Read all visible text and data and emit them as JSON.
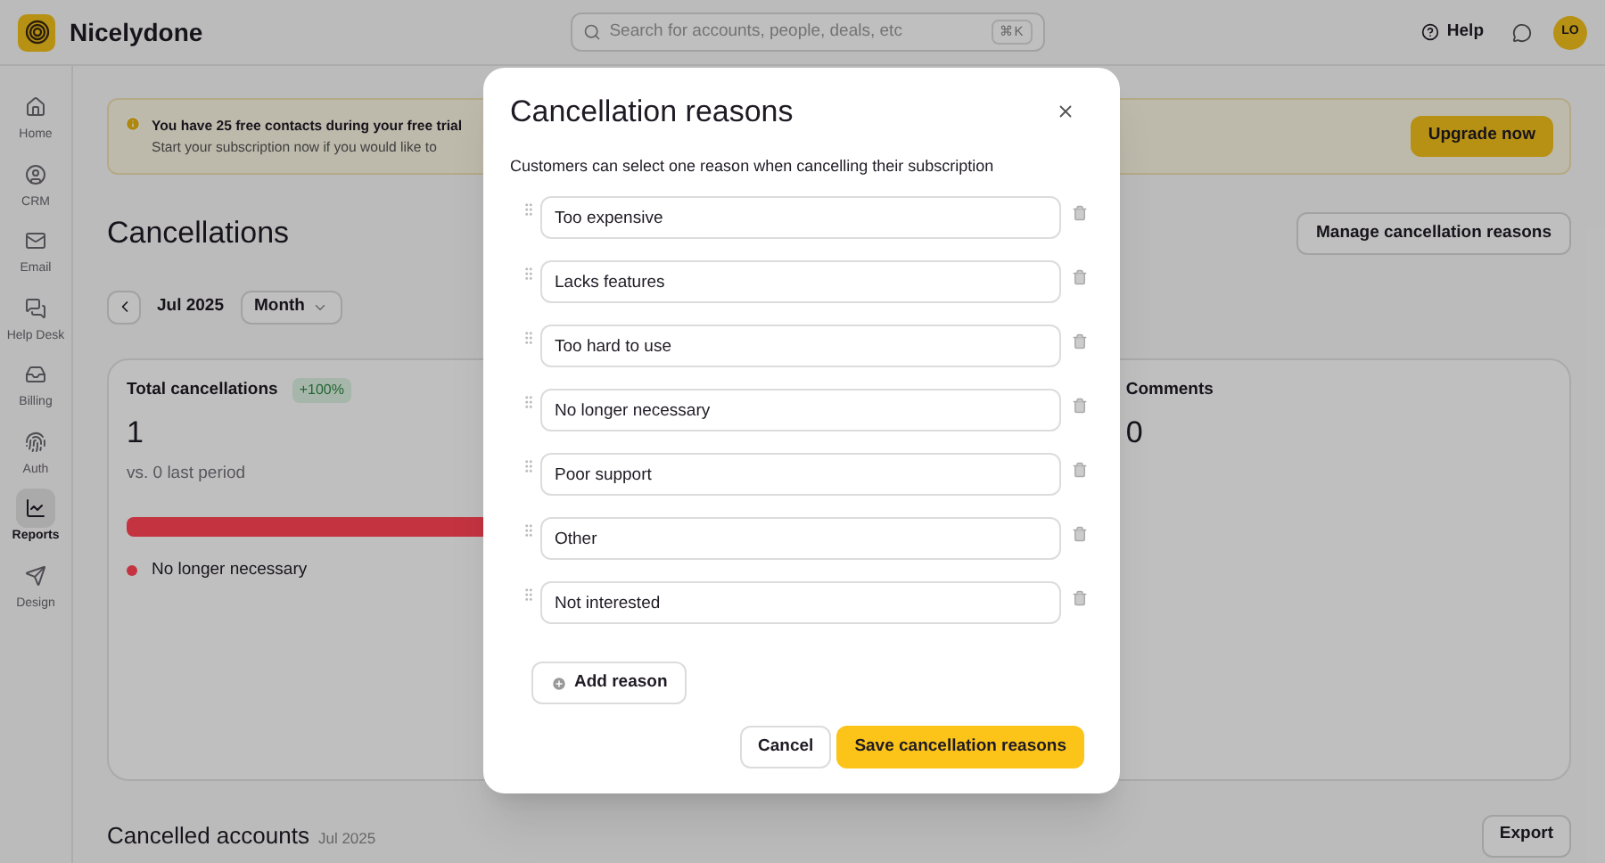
{
  "app": {
    "name": "Nicelydone"
  },
  "search": {
    "placeholder": "Search for accounts, people, deals, etc",
    "shortcut": "⌘K"
  },
  "header_actions": {
    "help": "Help",
    "avatar": "LO"
  },
  "sidebar": {
    "items": [
      {
        "label": "Home",
        "selected": false
      },
      {
        "label": "CRM",
        "selected": false
      },
      {
        "label": "Email",
        "selected": false
      },
      {
        "label": "Help Desk",
        "selected": false
      },
      {
        "label": "Billing",
        "selected": false
      },
      {
        "label": "Auth",
        "selected": false
      },
      {
        "label": "Reports",
        "selected": true
      },
      {
        "label": "Design",
        "selected": false
      }
    ]
  },
  "banner": {
    "title": "You have 25 free contacts during your free trial",
    "text": "Start your subscription now if you would like to",
    "button": "Upgrade now"
  },
  "page": {
    "title": "Cancellations",
    "manage_button": "Manage cancellation reasons",
    "period": "Jul 2025",
    "range": "Month"
  },
  "cards": [
    {
      "kind": "breakdown",
      "title": "Total cancellations",
      "badge": "+100%",
      "value": "1",
      "comparison": "vs. 0 last period",
      "legend": [
        {
          "label": "No longer necessary",
          "color": "#c43340"
        }
      ]
    },
    {
      "kind": "simple",
      "title": "Comments",
      "value": "0"
    }
  ],
  "section": {
    "title": "Cancelled accounts",
    "period": "Jul 2025",
    "export": "Export"
  },
  "dialog": {
    "title": "Cancellation reasons",
    "description": "Customers can select one reason when cancelling their subscription",
    "reasons": [
      {
        "value": "Too expensive"
      },
      {
        "value": "Lacks features"
      },
      {
        "value": "Too hard to use"
      },
      {
        "value": "No longer necessary"
      },
      {
        "value": "Poor support"
      },
      {
        "value": "Other"
      },
      {
        "value": "Not interested"
      }
    ],
    "add_button": "Add reason",
    "cancel": "Cancel",
    "save": "Save cancellation reasons"
  }
}
